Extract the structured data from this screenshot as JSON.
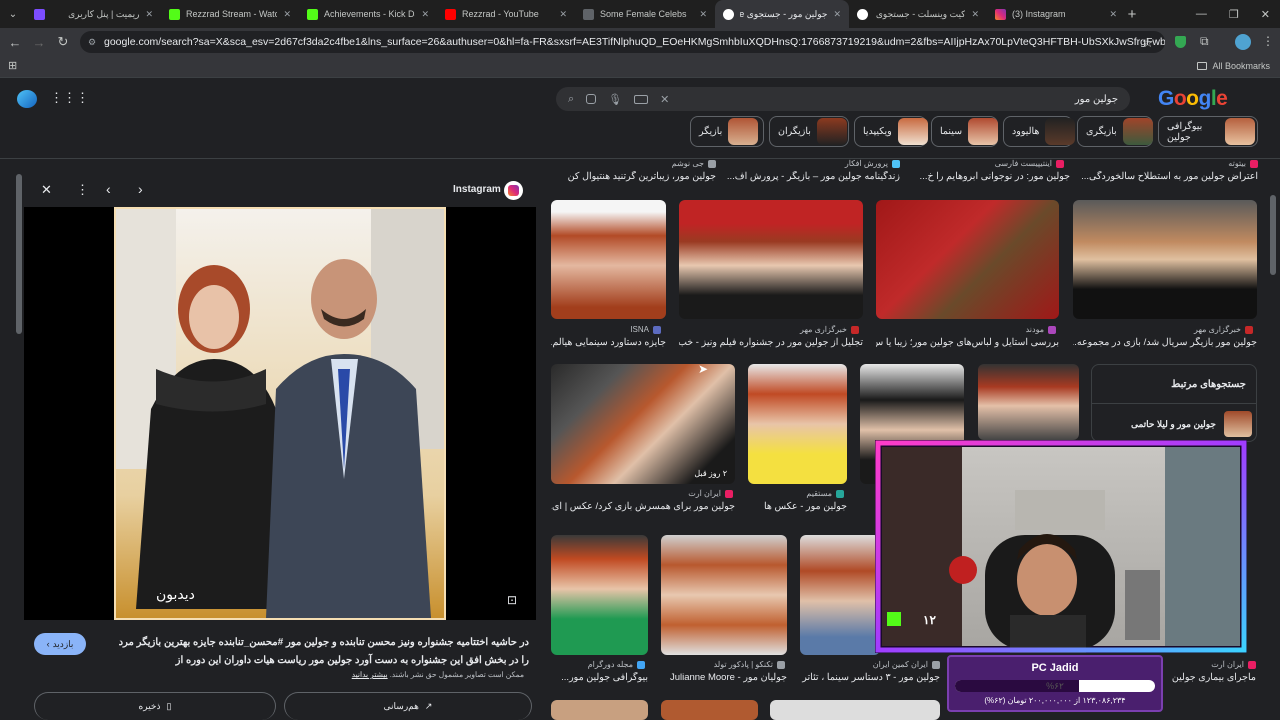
{
  "browser": {
    "tabs": [
      {
        "title": "ریمیت | پنل کاربری",
        "color": "#7c4dff"
      },
      {
        "title": "Rezzrad Stream - Watch L",
        "color": "#53fc18"
      },
      {
        "title": "Achievements - Kick Dash",
        "color": "#53fc18"
      },
      {
        "title": "Rezzrad - YouTube",
        "color": "#ff0000"
      },
      {
        "title": "Some Female Celebs",
        "color": "#3c4043"
      },
      {
        "title": "جولین مور - جستجوی Google",
        "color": "#ffffff",
        "active": true
      },
      {
        "title": "کیت وینسلت - جستجوی G",
        "color": "#ffffff"
      },
      {
        "title": "(3) Instagram",
        "color": "#e1306c"
      }
    ],
    "url": "google.com/search?sa=X&sca_esv=2d67cf3da2c4fbe1&lns_surface=26&authuser=0&hl=fa-FR&sxsrf=AE3TifNlphuQD_EOeHKMgSmhbIuXQDHnsQ:1766873719219&udm=2&fbs=AIIjpHzAx70LpVteQ3HFTBH-UbSXkJwSfrgFwbmlI2z_c8Q7HSS2O4cBc...",
    "all_bookmarks": "All Bookmarks"
  },
  "google": {
    "logo": "Google",
    "query": "جولین مور",
    "chips": [
      "بیوگرافی جولین",
      "بازیگری",
      "هالیوود",
      "سینما",
      "ویکیپدیا",
      "بازیگران",
      "بازیگر"
    ]
  },
  "left_panel": {
    "source": "Instagram",
    "image_watermark": "دیدبون",
    "description": "در حاشیه اختتامیه جشنواره ونیز محسن تنابنده و جولین مور #محسن_تنابنده جایزه بهترین بازیگر مرد را در بخش افق این جشنواره به دست آورد جولین مور ریاست هیات داوران این دوره از",
    "visit_button": "بازدید",
    "copyright_note": "ممکن است تصاویر مشمول حق نشر باشند.",
    "learn_more": "بیشتر بدانید",
    "save_button": "ذخیره",
    "share_button": "هم‌رسانی"
  },
  "results": {
    "top_row_captions": [
      {
        "source": "بیتوته",
        "caption": "اعتراض جولین مور به استطلاح سالخوردگی..."
      },
      {
        "source": "اینتیپیست فارسی",
        "caption": "جولین مور: در نوجوانی ابروهایم را خ..."
      },
      {
        "source": "پرورش افکار",
        "caption": "زندگینامه جولین مور – بازیگر - پرورش اف..."
      },
      {
        "source": "جی نوشم",
        "caption": "جولین مور، زیباترین گرتنید هنتیوال کن"
      }
    ],
    "row1": [
      {
        "source": "خبرگزاری مهر",
        "caption": "جولین مور بازیگر سریال شد/ بازی در مجموعه..."
      },
      {
        "source": "مودند",
        "caption": "بررسی استایل و لباس‌های جولین مور؛ زیبا یا س..."
      },
      {
        "source": "خبرگزاری مهر",
        "caption": "تجلیل از جولین مور در جشنواره فیلم ونیز - خب..."
      },
      {
        "source": "ISNA",
        "caption": "جایزه دستاورد سینمایی هیالم..."
      }
    ],
    "related": {
      "title": "جستجوهای مرتبط",
      "item": "جولین مور و لیلا حاتمی"
    },
    "row2": [
      {
        "source": "مستقیم",
        "caption": "جولین مور - عکس ها"
      },
      {
        "source": "ایران آرت",
        "caption": "جولین مور برای همسرش بازی کرد/ عکس | ای..."
      }
    ],
    "row2_badge": "۲ روز قبل",
    "row3": [
      {
        "source": "ایران آرت",
        "caption": "ماجرای بیماری جولین مور..."
      },
      {
        "source": "ایران کمین ایران",
        "caption": "جولین مور - ۳ دستاسر سینما ، تئاتر و موسیقی..."
      },
      {
        "source": "تکنکو | پادکور تولد",
        "caption": "جولیان مور - Julianne Moore"
      },
      {
        "source": "مجله دورگرام",
        "caption": "بیوگرافی جولین مور..."
      }
    ]
  },
  "stream_overlay": {
    "kick_count": "۱۲",
    "donation_title": "PC Jadid",
    "donation_percent_label": "%۶۲",
    "donation_progress": 0.62,
    "donation_text": "۱۲۳,۰۸۶,۲۳۴ از ۲۰۰,۰۰۰,۰۰۰ تومان (۶۲%)"
  }
}
